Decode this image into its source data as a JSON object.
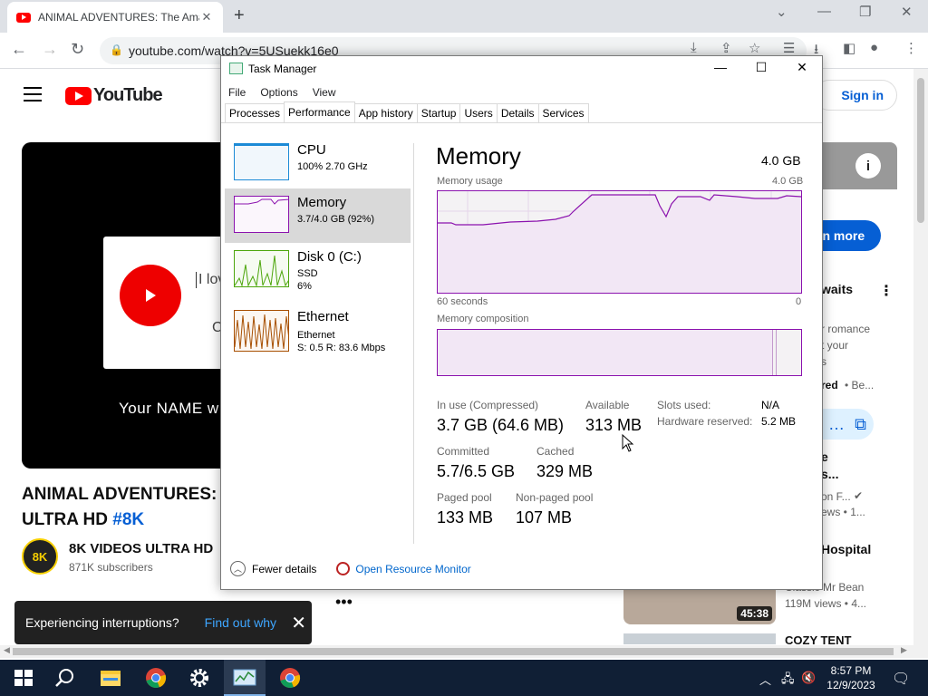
{
  "browser": {
    "tab_title": "ANIMAL ADVENTURES: The Amazing",
    "url": "youtube.com/watch?v=5USuekk16e0"
  },
  "youtube": {
    "logo_text": "YouTube",
    "sign_in": "Sign in",
    "video_text_love": "I lov",
    "video_text_c": "C",
    "video_text_name": "Your NAME w",
    "title_line1": "ANIMAL ADVENTURES: T",
    "title_line2": "ULTRA HD",
    "title_tag": "#8K",
    "channel_avatar_text": "8K",
    "channel_name": "8K VIDEOS ULTRA HD",
    "channel_subs": "871K subscribers",
    "toast_text": "Experiencing interruptions?",
    "toast_link": "Find out why",
    "side_learn": "rn more",
    "side_awaits": "waits",
    "side_romance_1": "r romance",
    "side_romance_2": "t your",
    "side_romance_3": "s",
    "side_red": "red",
    "side_be": "• Be...",
    "side_e": "e",
    "side_s": "s...",
    "side_on": "on F...",
    "side_ews": "ews • 1...",
    "side_hospital": "Hospital",
    "side_mrbean": "Classic Mr Bean",
    "side_views": "119M views • 4...",
    "side_duration": "45:38",
    "side_cozy": "COZY TENT"
  },
  "task_manager": {
    "title": "Task Manager",
    "menu": [
      "File",
      "Options",
      "View"
    ],
    "tabs": [
      "Processes",
      "Performance",
      "App history",
      "Startup",
      "Users",
      "Details",
      "Services"
    ],
    "resources": [
      {
        "name": "CPU",
        "sub1": "100% 2.70 GHz",
        "sub2": "",
        "color": "#1c8ad6"
      },
      {
        "name": "Memory",
        "sub1": "3.7/4.0 GB (92%)",
        "sub2": "",
        "color": "#8b12ae"
      },
      {
        "name": "Disk 0 (C:)",
        "sub1": "SSD",
        "sub2": "6%",
        "color": "#4da60c"
      },
      {
        "name": "Ethernet",
        "sub1": "Ethernet",
        "sub2": "S: 0.5 R: 83.6 Mbps",
        "color": "#a74f01"
      }
    ],
    "memory": {
      "heading": "Memory",
      "total": "4.0 GB",
      "usage_label": "Memory usage",
      "usage_max": "4.0 GB",
      "time_label": "60 seconds",
      "time_zero": "0",
      "composition_label": "Memory composition",
      "in_use_label": "In use (Compressed)",
      "in_use_value": "3.7 GB (64.6 MB)",
      "available_label": "Available",
      "available_value": "313 MB",
      "committed_label": "Committed",
      "committed_value": "5.7/6.5 GB",
      "cached_label": "Cached",
      "cached_value": "329 MB",
      "paged_label": "Paged pool",
      "paged_value": "133 MB",
      "nonpaged_label": "Non-paged pool",
      "nonpaged_value": "107 MB",
      "slots_label": "Slots used:",
      "slots_value": "N/A",
      "hw_label": "Hardware reserved:",
      "hw_value": "5.2 MB"
    },
    "footer": {
      "fewer": "Fewer details",
      "resource_monitor": "Open Resource Monitor"
    }
  },
  "taskbar": {
    "time": "8:57 PM",
    "date": "12/9/2023"
  }
}
